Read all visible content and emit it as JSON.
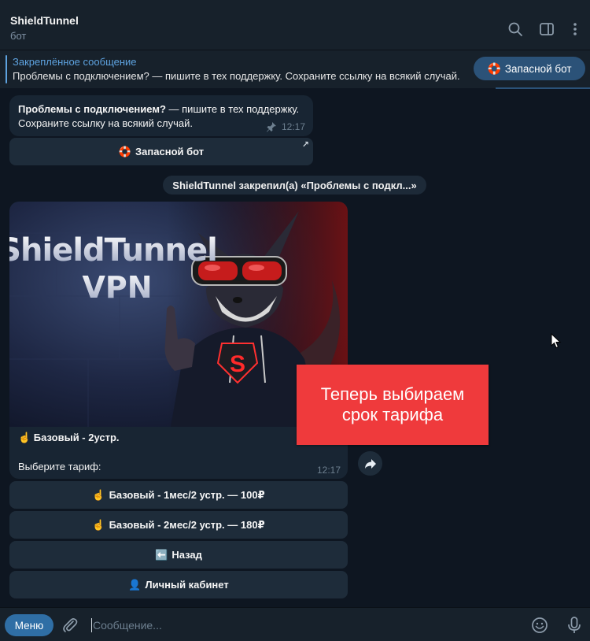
{
  "header": {
    "title": "ShieldTunnel",
    "subtitle": "бот",
    "icons": [
      "search-icon",
      "sidebar-toggle-icon",
      "more-vertical-icon"
    ]
  },
  "pinned": {
    "title": "Закреплённое сообщение",
    "text": "Проблемы с подключением? — пишите в тех поддержку. Сохраните ссылку на всякий случай.",
    "button_emoji": "🛟",
    "button_label": "Запасной бот"
  },
  "messages": {
    "first": {
      "bold": "Проблемы с подключением?",
      "rest": " — пишите в тех поддержку.",
      "line2": "Сохраните ссылку на всякий случай.",
      "time": "12:17",
      "keyboard": [
        {
          "emoji": "🛟",
          "label": "Запасной бот"
        }
      ]
    },
    "service": "ShieldTunnel закрепил(а) «Проблемы с подкл...»",
    "second": {
      "photo_text_line1": "ShieldTunnel",
      "photo_text_line2": "VPN",
      "photo_badge": "S",
      "line1": "☝️ Базовый - 2устр.",
      "line2": "Выберите тариф:",
      "time": "12:17",
      "keyboard": [
        {
          "emoji": "☝️",
          "label": "Базовый - 1мес/2 устр. — 100₽"
        },
        {
          "emoji": "☝️",
          "label": "Базовый - 2мес/2 устр. — 180₽"
        },
        {
          "emoji": "⬅️",
          "label": "Назад"
        },
        {
          "emoji": "👤",
          "label": "Личный кабинет"
        }
      ]
    }
  },
  "callout": {
    "line1": "Теперь выбираем",
    "line2": "срок тарифа",
    "color": "#ef3a3c"
  },
  "composer": {
    "menu_label": "Меню",
    "placeholder": "Сообщение..."
  },
  "colors": {
    "background": "#0e1621",
    "panel": "#17212b",
    "bubble": "#182533",
    "button": "#1e2c3a",
    "accent": "#5ea3e0",
    "menu_button": "#2f6ea5"
  }
}
